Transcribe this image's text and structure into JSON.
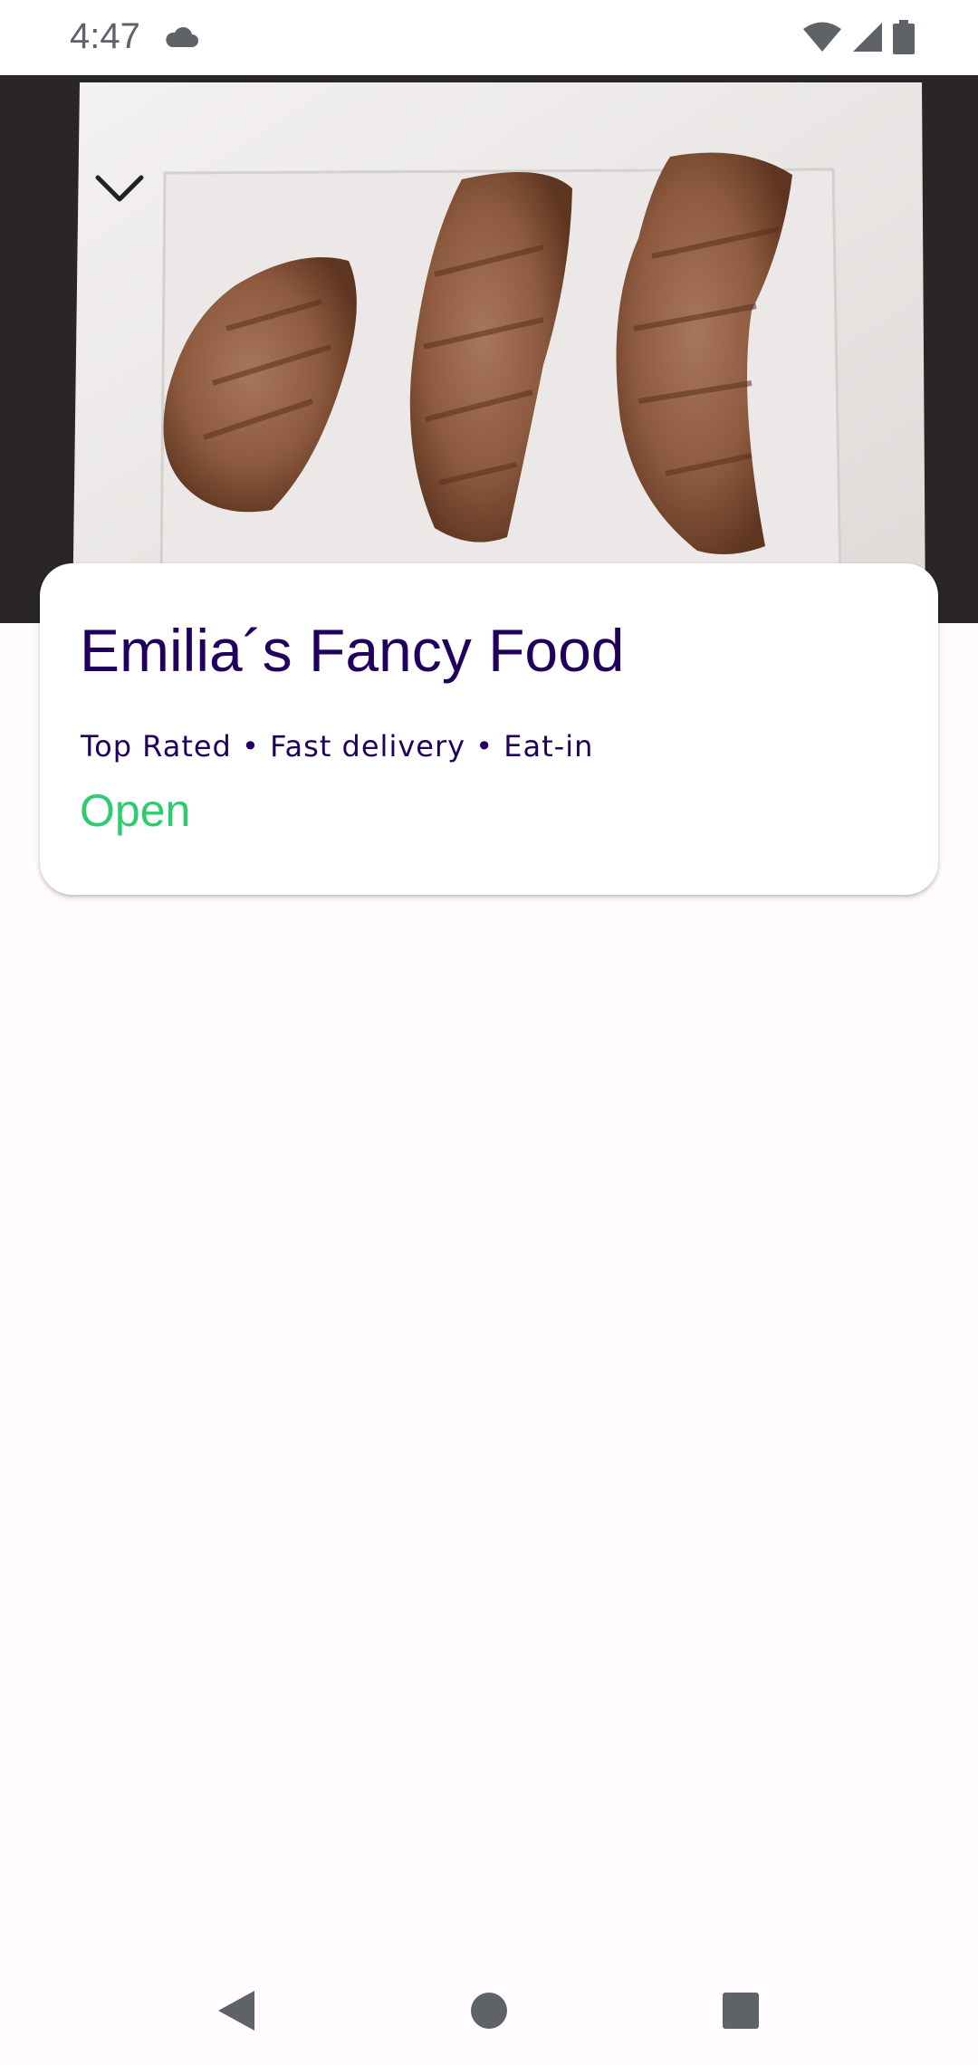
{
  "status_bar": {
    "time": "4:47",
    "icons": [
      "cloud-icon",
      "wifi-icon",
      "cellular-signal-icon",
      "battery-icon"
    ],
    "icon_color": "#5f6368"
  },
  "hero": {
    "image": "plate-of-grilled-steak-slices",
    "collapse_icon": "chevron-down-icon"
  },
  "restaurant": {
    "name": "Emilia´s Fancy Food",
    "tags": "Top Rated • Fast delivery • Eat-in",
    "status": "Open"
  },
  "colors": {
    "title": "#21005d",
    "open_status": "#2ecc71",
    "nav_icons": "#5f6368"
  },
  "nav_bar": {
    "icons": [
      "back-icon",
      "home-icon",
      "recents-icon"
    ]
  }
}
